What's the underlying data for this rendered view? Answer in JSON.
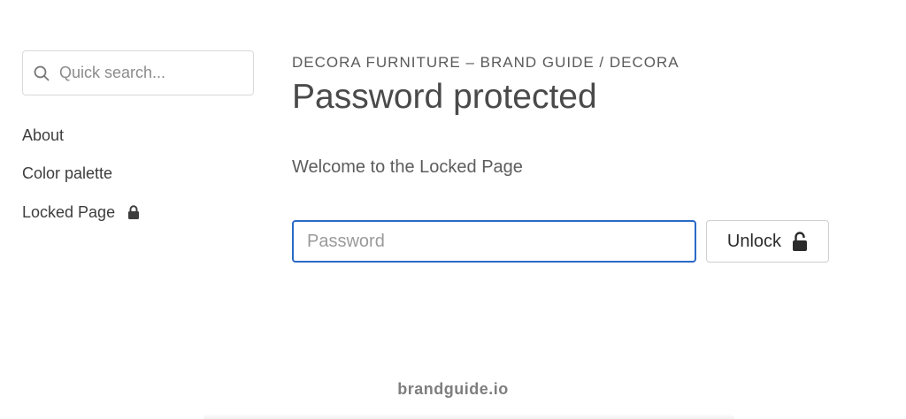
{
  "search": {
    "placeholder": "Quick search..."
  },
  "sidebar": {
    "items": [
      {
        "label": "About",
        "locked": false
      },
      {
        "label": "Color palette",
        "locked": false
      },
      {
        "label": "Locked Page",
        "locked": true
      }
    ]
  },
  "main": {
    "breadcrumb": "DECORA FURNITURE – BRAND GUIDE / DECORA",
    "title": "Password protected",
    "welcome": "Welcome to the Locked Page",
    "password_placeholder": "Password",
    "unlock_label": "Unlock"
  },
  "footer": {
    "brand": "brandguide.io"
  },
  "colors": {
    "focus_border": "#2a6ac6",
    "text": "#3a3a3a"
  }
}
